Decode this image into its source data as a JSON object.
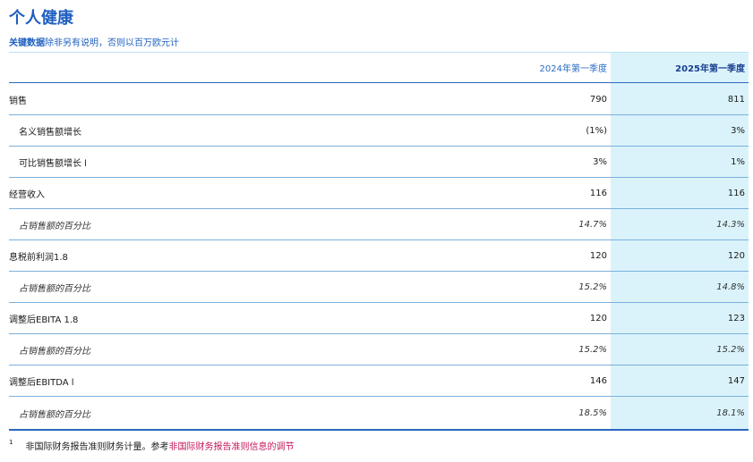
{
  "title": "个人健康",
  "subtitle": {
    "bold": "关键数据",
    "rest": "除非另有说明，否则以百万欧元计"
  },
  "table": {
    "col_2024": "2024年第一季度",
    "col_2025": "2025年第一季度",
    "rows": [
      {
        "label": "销售",
        "v2024": "790",
        "v2025": "811"
      },
      {
        "label": "名义销售额增长",
        "v2024": "(1%)",
        "v2025": "3%"
      },
      {
        "label": "可比销售额增长 l",
        "v2024": "3%",
        "v2025": "1%"
      },
      {
        "label": "经营收入",
        "v2024": "116",
        "v2025": "116"
      },
      {
        "label": "占销售额的百分比",
        "v2024": "14.7%",
        "v2025": "14.3%"
      },
      {
        "label": "息税前利润1.8",
        "v2024": "120",
        "v2025": "120"
      },
      {
        "label": "占销售额的百分比",
        "v2024": "15.2%",
        "v2025": "14.8%"
      },
      {
        "label": "调整后EBITA 1.8",
        "v2024": "120",
        "v2025": "123"
      },
      {
        "label": "占销售额的百分比",
        "v2024": "15.2%",
        "v2025": "15.2%"
      },
      {
        "label": "调整后EBITDA l",
        "v2024": "146",
        "v2025": "147"
      },
      {
        "label": "占销售额的百分比",
        "v2024": "18.5%",
        "v2025": "18.1%"
      }
    ]
  },
  "footnote": {
    "marker": "1",
    "text": "非国际财务报告准则财务计量。参考",
    "link": "非国际财务报告准则信息的调节"
  }
}
